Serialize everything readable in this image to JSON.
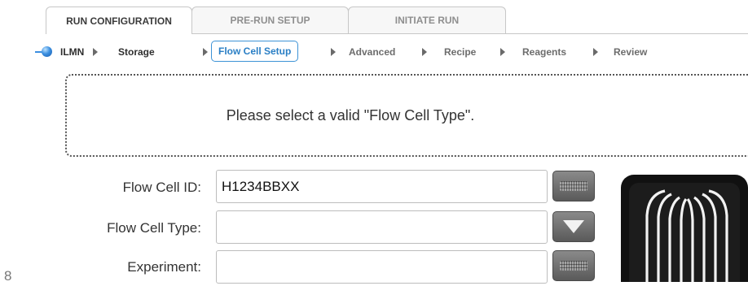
{
  "tabs": [
    {
      "label": "RUN CONFIGURATION",
      "active": true
    },
    {
      "label": "PRE-RUN SETUP",
      "active": false
    },
    {
      "label": "INITIATE RUN",
      "active": false
    }
  ],
  "steps": [
    {
      "label": "ILMN",
      "state": "done"
    },
    {
      "label": "Storage",
      "state": "done"
    },
    {
      "label": "Flow Cell Setup",
      "state": "current"
    },
    {
      "label": "Advanced",
      "state": "pending"
    },
    {
      "label": "Recipe",
      "state": "pending"
    },
    {
      "label": "Reagents",
      "state": "pending"
    },
    {
      "label": "Review",
      "state": "pending"
    }
  ],
  "message": "Please select a valid \"Flow Cell Type\".",
  "form": {
    "flow_cell_id": {
      "label": "Flow Cell ID:",
      "value": "H1234BBXX",
      "button_icon": "keyboard-icon"
    },
    "flow_cell_type": {
      "label": "Flow Cell Type:",
      "value": "",
      "button_icon": "dropdown-arrow-icon"
    },
    "experiment": {
      "label": "Experiment:",
      "value": "",
      "button_icon": "keyboard-icon"
    }
  },
  "stray_glyph": "8",
  "colors": {
    "accent": "#3d93d6",
    "tab_border": "#c7c7c7",
    "button_dark": "#5a5a5a"
  }
}
